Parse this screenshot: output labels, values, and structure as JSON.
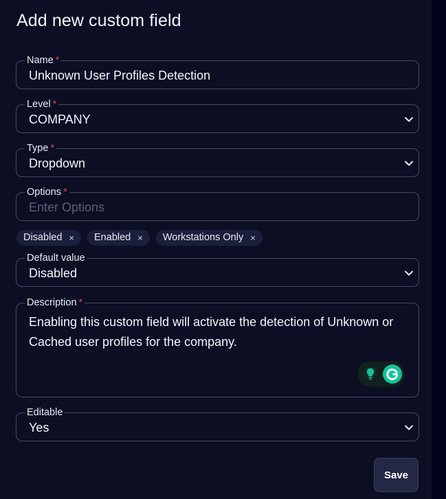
{
  "dialog": {
    "title": "Add new custom field",
    "save_label": "Save"
  },
  "fields": {
    "name": {
      "label": "Name",
      "required_mark": "*",
      "value": "Unknown User Profiles Detection"
    },
    "level": {
      "label": "Level",
      "required_mark": "*",
      "value": "COMPANY"
    },
    "type": {
      "label": "Type",
      "required_mark": "*",
      "value": "Dropdown"
    },
    "options": {
      "label": "Options",
      "required_mark": "*",
      "placeholder": "Enter Options",
      "chips": [
        "Disabled",
        "Enabled",
        "Workstations Only"
      ],
      "chip_remove": "×"
    },
    "default_value": {
      "label": "Default value",
      "value": "Disabled"
    },
    "description": {
      "label": "Description",
      "required_mark": "*",
      "value": "Enabling this custom field will activate the detection of Unknown or Cached user profiles for the company."
    },
    "editable": {
      "label": "Editable",
      "value": "Yes"
    }
  },
  "icons": {
    "chevron": "chevron-down-icon",
    "chip_remove": "close-icon",
    "grammarly_suggestion": "lightbulb-icon",
    "grammarly_logo": "grammarly-g-icon"
  },
  "colors": {
    "background": "#0c0e24",
    "required": "#e0453c",
    "border": "#474a62",
    "save_button": "#232845",
    "grammarly_green": "#15c39a"
  }
}
